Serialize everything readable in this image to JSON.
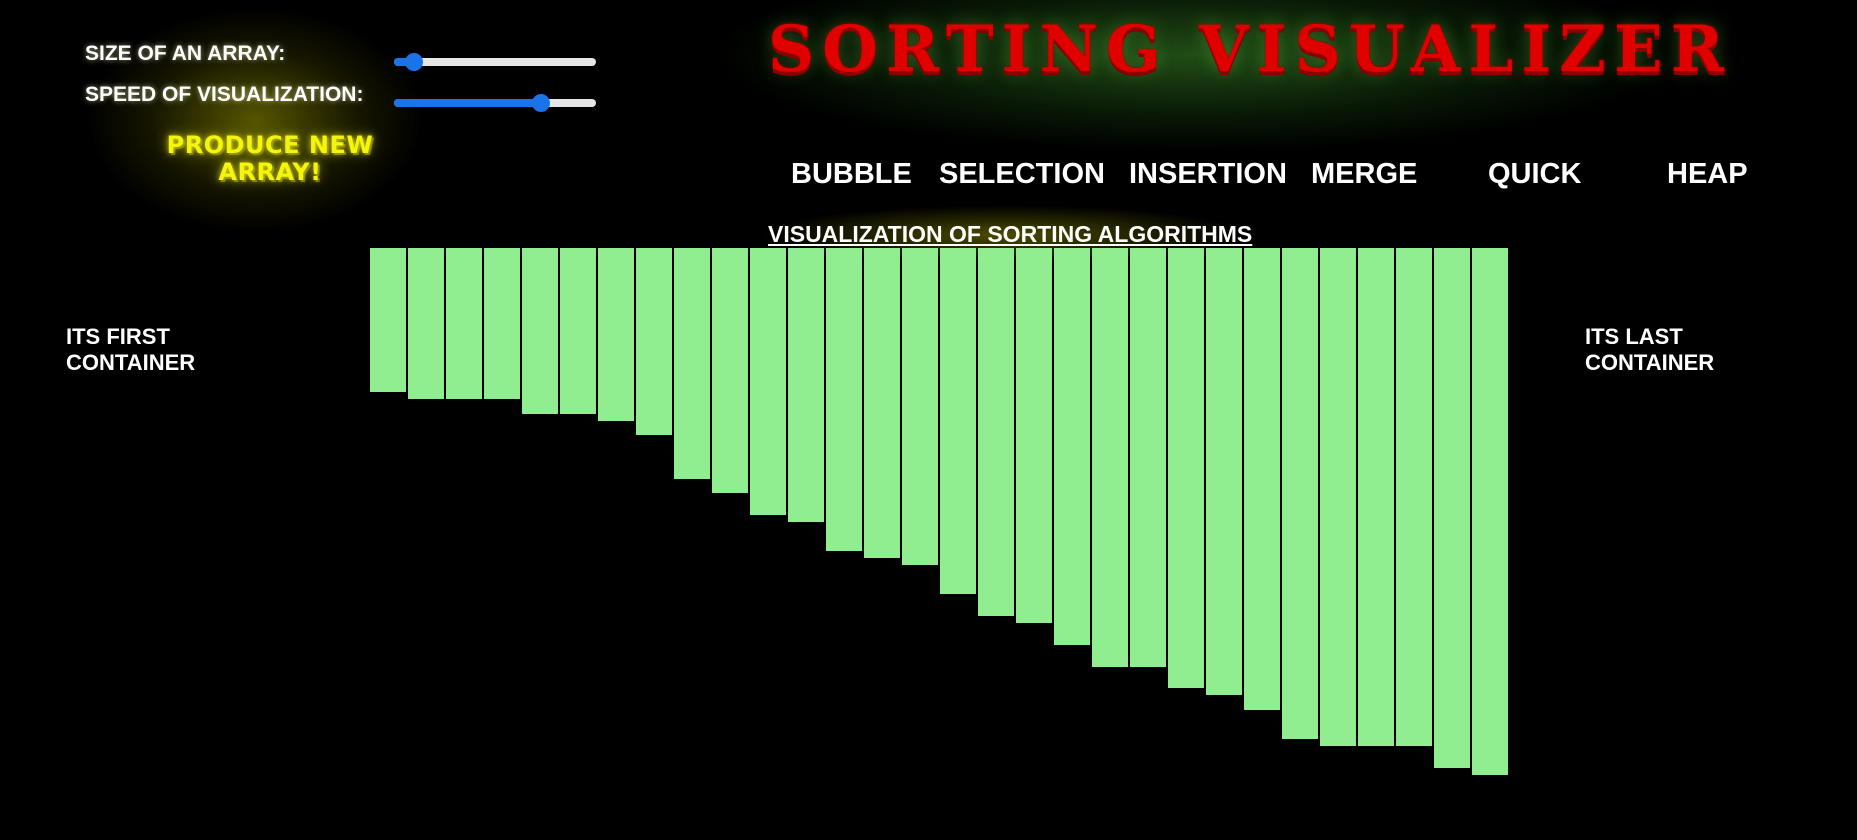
{
  "controls": {
    "size_label": "SIZE OF AN ARRAY:",
    "speed_label": "SPEED OF VISUALIZATION:",
    "size_slider_fraction": 0.1,
    "speed_slider_fraction": 0.73,
    "new_array_label": "PRODUCE NEW ARRAY!"
  },
  "title": "SORTING VISUALIZER",
  "algorithms": [
    {
      "label": "BUBBLE"
    },
    {
      "label": "SELECTION"
    },
    {
      "label": "INSERTION"
    },
    {
      "label": "MERGE"
    },
    {
      "label": "QUICK"
    },
    {
      "label": "HEAP"
    }
  ],
  "caption": "VISUALIZATION OF SORTING ALGORITHMS",
  "first_container": [
    "ITS FIRST",
    "CONTAINER"
  ],
  "last_container": [
    "ITS LAST",
    "CONTAINER"
  ],
  "colors": {
    "background": "#000000",
    "bar": "#90ee90",
    "title": "#e00000",
    "button_text": "#f4f40c",
    "slider": "#1a73e8"
  },
  "array_values": [
    144,
    151,
    151,
    151,
    166,
    166,
    173,
    187,
    231,
    245,
    267,
    274,
    303,
    310,
    317,
    346,
    368,
    375,
    397,
    419,
    419,
    440,
    447,
    462,
    491,
    498,
    498,
    498,
    520,
    527
  ]
}
